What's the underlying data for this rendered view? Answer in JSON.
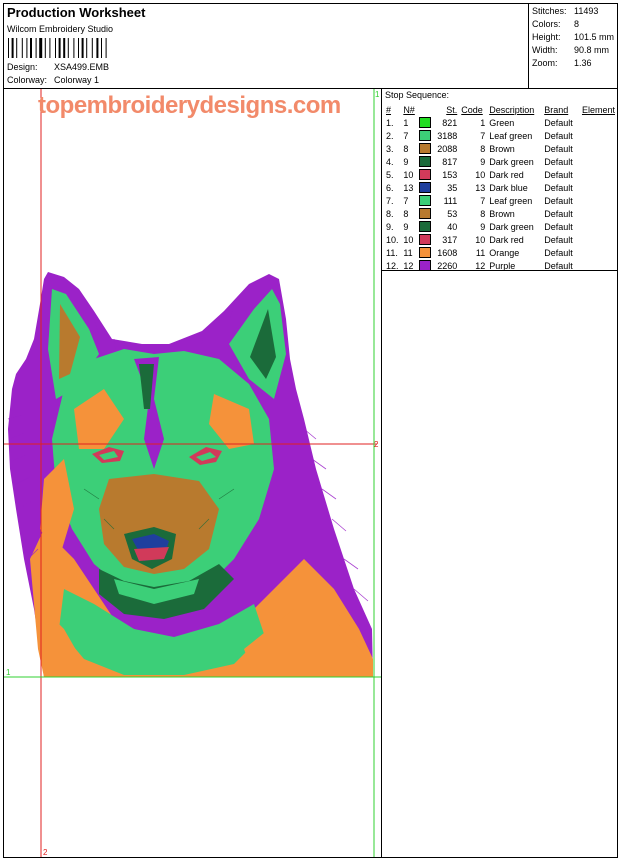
{
  "header": {
    "title": "Production Worksheet",
    "software": "Wilcom Embroidery Studio",
    "design_label": "Design:",
    "design_value": "XSA499.EMB",
    "colorway_label": "Colorway:",
    "colorway_value": "Colorway 1"
  },
  "stats": [
    {
      "label": "Stitches:",
      "value": "11493"
    },
    {
      "label": "Colors:",
      "value": "8"
    },
    {
      "label": "Height:",
      "value": "101.5 mm"
    },
    {
      "label": "Width:",
      "value": "90.8 mm"
    },
    {
      "label": "Zoom:",
      "value": "1.36"
    }
  ],
  "watermark": "topembroiderydesigns.com",
  "guides": {
    "mark1": "1",
    "mark2": "2"
  },
  "stop_sequence": {
    "title": "Stop Sequence:",
    "headers": [
      "#",
      "N#",
      "St.",
      "Code",
      "Description",
      "Brand",
      "Element"
    ],
    "rows": [
      {
        "num": "1.",
        "n": "1",
        "color": "#22dd22",
        "st": "821",
        "code": "1",
        "desc": "Green",
        "brand": "Default"
      },
      {
        "num": "2.",
        "n": "7",
        "color": "#3ccf78",
        "st": "3188",
        "code": "7",
        "desc": "Leaf green",
        "brand": "Default"
      },
      {
        "num": "3.",
        "n": "8",
        "color": "#b87a2e",
        "st": "2088",
        "code": "8",
        "desc": "Brown",
        "brand": "Default"
      },
      {
        "num": "4.",
        "n": "9",
        "color": "#1b6b3a",
        "st": "817",
        "code": "9",
        "desc": "Dark green",
        "brand": "Default"
      },
      {
        "num": "5.",
        "n": "10",
        "color": "#d13a5a",
        "st": "153",
        "code": "10",
        "desc": "Dark red",
        "brand": "Default"
      },
      {
        "num": "6.",
        "n": "13",
        "color": "#1f3f9e",
        "st": "35",
        "code": "13",
        "desc": "Dark blue",
        "brand": "Default"
      },
      {
        "num": "7.",
        "n": "7",
        "color": "#3ccf78",
        "st": "111",
        "code": "7",
        "desc": "Leaf green",
        "brand": "Default"
      },
      {
        "num": "8.",
        "n": "8",
        "color": "#b87a2e",
        "st": "53",
        "code": "8",
        "desc": "Brown",
        "brand": "Default"
      },
      {
        "num": "9.",
        "n": "9",
        "color": "#1b6b3a",
        "st": "40",
        "code": "9",
        "desc": "Dark green",
        "brand": "Default"
      },
      {
        "num": "10.",
        "n": "10",
        "color": "#d13a5a",
        "st": "317",
        "code": "10",
        "desc": "Dark red",
        "brand": "Default"
      },
      {
        "num": "11.",
        "n": "11",
        "color": "#f5923a",
        "st": "1608",
        "code": "11",
        "desc": "Orange",
        "brand": "Default"
      },
      {
        "num": "12.",
        "n": "12",
        "color": "#9b22c8",
        "st": "2260",
        "code": "12",
        "desc": "Purple",
        "brand": "Default"
      }
    ]
  },
  "colors": {
    "guide_red": "#e02020",
    "guide_green": "#30d030",
    "purple": "#9b22c8",
    "leaf_green": "#3ccf78",
    "orange": "#f5923a",
    "brown": "#b87a2e",
    "dark_green": "#1b6b3a",
    "dark_red": "#d13a5a",
    "dark_blue": "#1f3f9e"
  }
}
